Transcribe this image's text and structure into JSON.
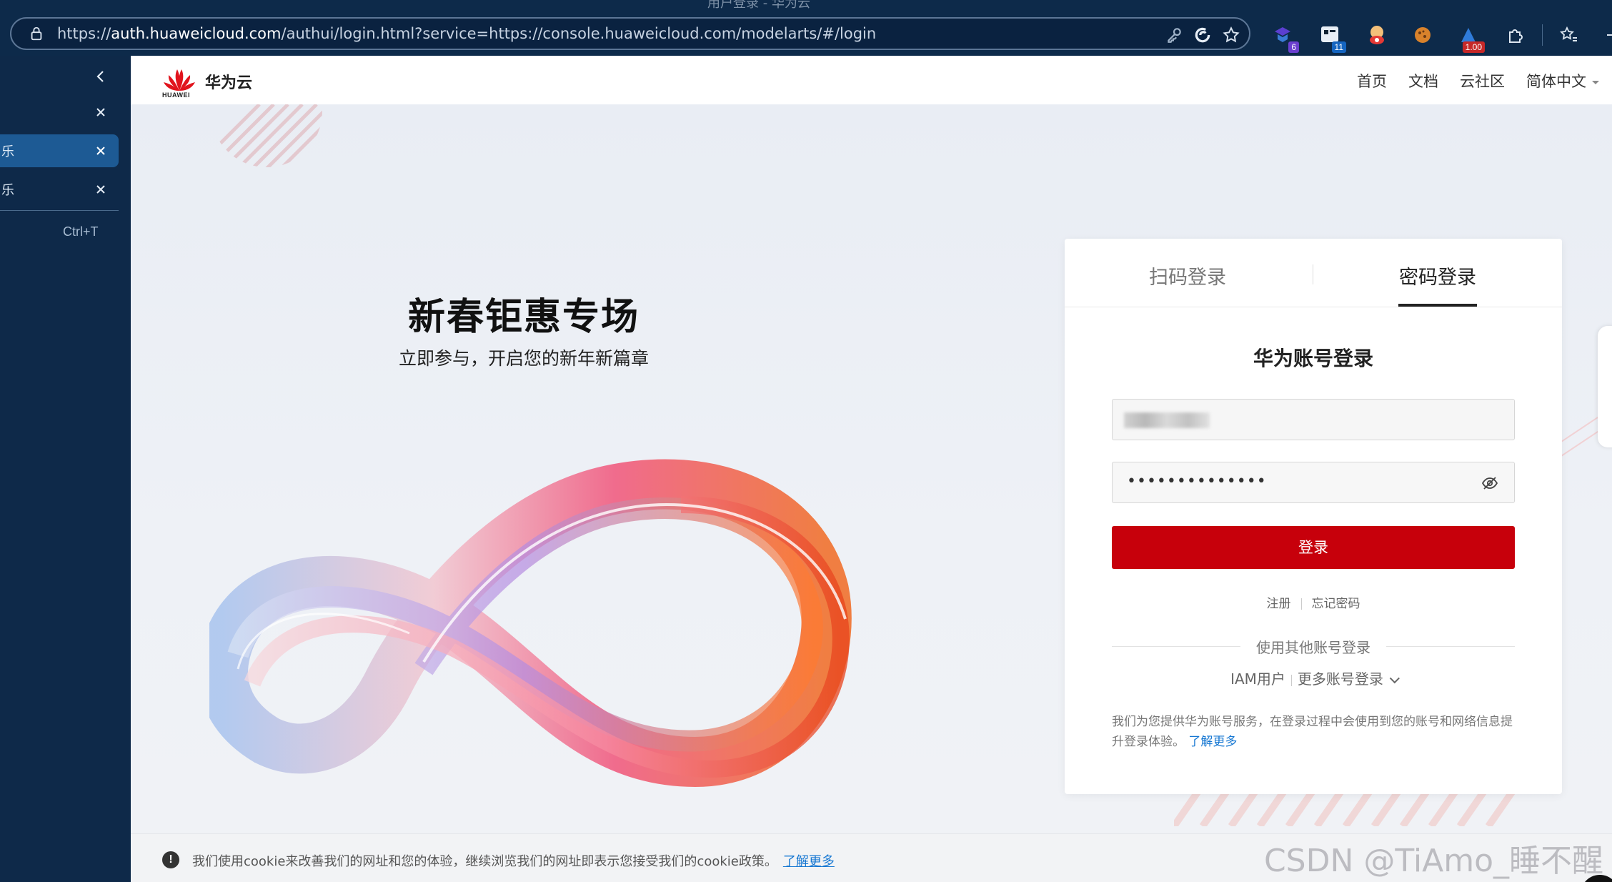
{
  "browser": {
    "window_title": "用户登录 - 华为云",
    "url_prefix": "https://",
    "url_host": "auth.huaweicloud.com",
    "url_rest": "/authui/login.html?service=https://console.huaweicloud.com/modelarts/#/login",
    "extensions": [
      {
        "name": "ext-1-icon",
        "badge": "6",
        "badge_color": "#6b3fcf"
      },
      {
        "name": "ext-2-icon",
        "badge": "11",
        "badge_color": "#1565c0"
      },
      {
        "name": "ext-3-icon",
        "badge": "",
        "badge_color": ""
      },
      {
        "name": "cookie-icon",
        "badge": "",
        "badge_color": ""
      },
      {
        "name": "ext-5-icon",
        "badge": "1.00",
        "badge_color": "#c62828"
      }
    ]
  },
  "sidebar": {
    "rows": [
      {
        "label": "",
        "active": false
      },
      {
        "label": "",
        "active": false
      },
      {
        "label": "乐",
        "active": true
      },
      {
        "label": "乐",
        "active": false
      }
    ],
    "new_tab_shortcut": "Ctrl+T"
  },
  "header": {
    "brand": "华为云",
    "logo_word": "HUAWEI",
    "nav": [
      "首页",
      "文档",
      "云社区",
      "简体中文"
    ]
  },
  "hero": {
    "title": "新春钜惠专场",
    "subtitle": "立即参与，开启您的新年新篇章"
  },
  "login": {
    "tab_qr": "扫码登录",
    "tab_password": "密码登录",
    "title": "华为账号登录",
    "password_mask": "••••••••••••••",
    "login_button": "登录",
    "register": "注册",
    "forgot": "忘记密码",
    "other_login": "使用其他账号登录",
    "iam_user": "IAM用户",
    "more_login": "更多账号登录",
    "notice": "我们为您提供华为账号服务，在登录过程中会使用到您的账号和网络信息提升登录体验。",
    "learn_more": "了解更多"
  },
  "cookie": {
    "message": "我们使用cookie来改善我们的网址和您的体验，继续浏览我们的网址即表示您接受我们的cookie政策。",
    "link": "了解更多"
  },
  "watermark": "CSDN @TiAmo_睡不醒",
  "colors": {
    "accent_red": "#c7000b",
    "link_blue": "#1677d2",
    "chrome_bg": "#0d2a4a"
  }
}
